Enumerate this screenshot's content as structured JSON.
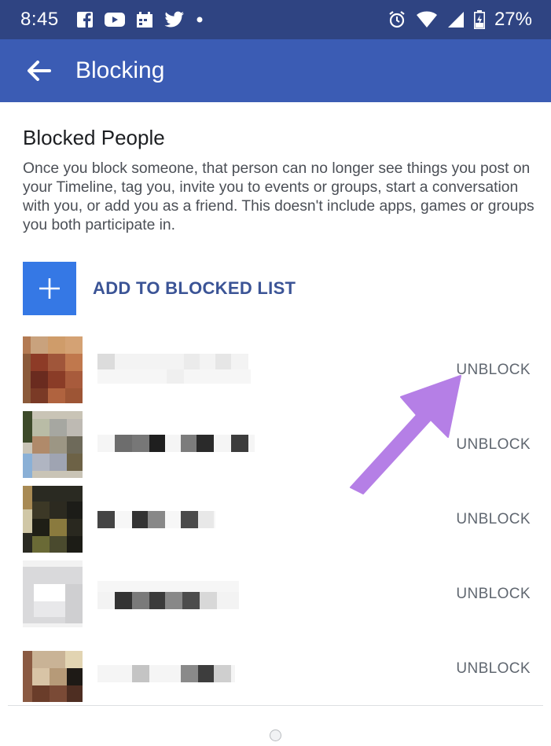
{
  "status_bar": {
    "time": "8:45",
    "battery": "27%",
    "left_icons": [
      "facebook-icon",
      "youtube-icon",
      "calendar-icon",
      "twitter-icon",
      "dot-icon"
    ],
    "right_icons": [
      "alarm-icon",
      "wifi-icon",
      "signal-icon",
      "battery-icon"
    ]
  },
  "app_bar": {
    "title": "Blocking",
    "back_icon": "arrow-left-icon",
    "color": "#3b5cb4"
  },
  "section": {
    "title": "Blocked People",
    "description": "Once you block someone, that person can no longer see things you post on your Timeline, tag you, invite you to events or groups, start a conversation with you, or add you as a friend. This doesn't include apps, games or groups you both participate in."
  },
  "add_button": {
    "label": "ADD TO BLOCKED LIST",
    "icon": "plus-icon",
    "color": "#3578e5"
  },
  "blocked_list": [
    {
      "unblock_label": "UNBLOCK"
    },
    {
      "unblock_label": "UNBLOCK"
    },
    {
      "unblock_label": "UNBLOCK"
    },
    {
      "unblock_label": "UNBLOCK"
    },
    {
      "unblock_label": "UNBLOCK"
    }
  ],
  "annotation": {
    "type": "arrow",
    "color": "#b57fe6"
  }
}
